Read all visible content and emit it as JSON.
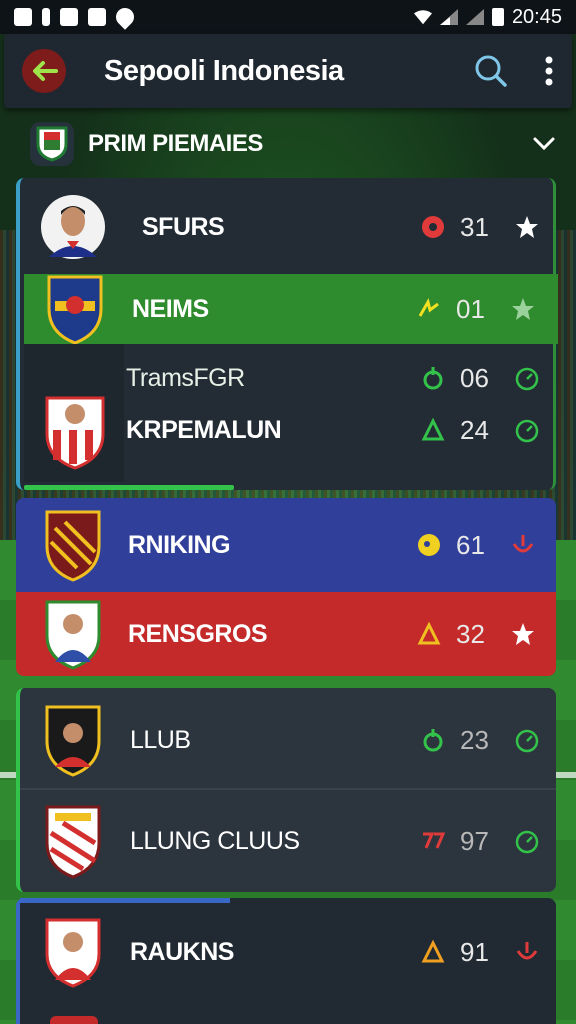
{
  "status_bar": {
    "time": "20:45"
  },
  "app_bar": {
    "title": "Sepooli Indonesia"
  },
  "league": {
    "name": "PRIM PIEMAIES"
  },
  "rows": [
    {
      "label": "SFURS",
      "value": "31"
    },
    {
      "label": "NEIMS",
      "value": "01"
    },
    {
      "label": "TramsFGR",
      "value": "06"
    },
    {
      "label": "KRPEMALUN",
      "value": "24"
    },
    {
      "label": "RNIKING",
      "value": "61"
    },
    {
      "label": "RENSGROS",
      "value": "32"
    },
    {
      "label": "LLUB",
      "value": "23"
    },
    {
      "label": "LLUNG CLUUS",
      "value": "97"
    },
    {
      "label": "RAUKNS",
      "value": "91"
    }
  ],
  "colors": {
    "accent_green": "#2e8b2e",
    "accent_blue": "#2f3f9a",
    "accent_red": "#c42a2a",
    "icon_green": "#33c24a",
    "icon_red": "#e03a3a",
    "icon_yellow": "#f0c020"
  }
}
